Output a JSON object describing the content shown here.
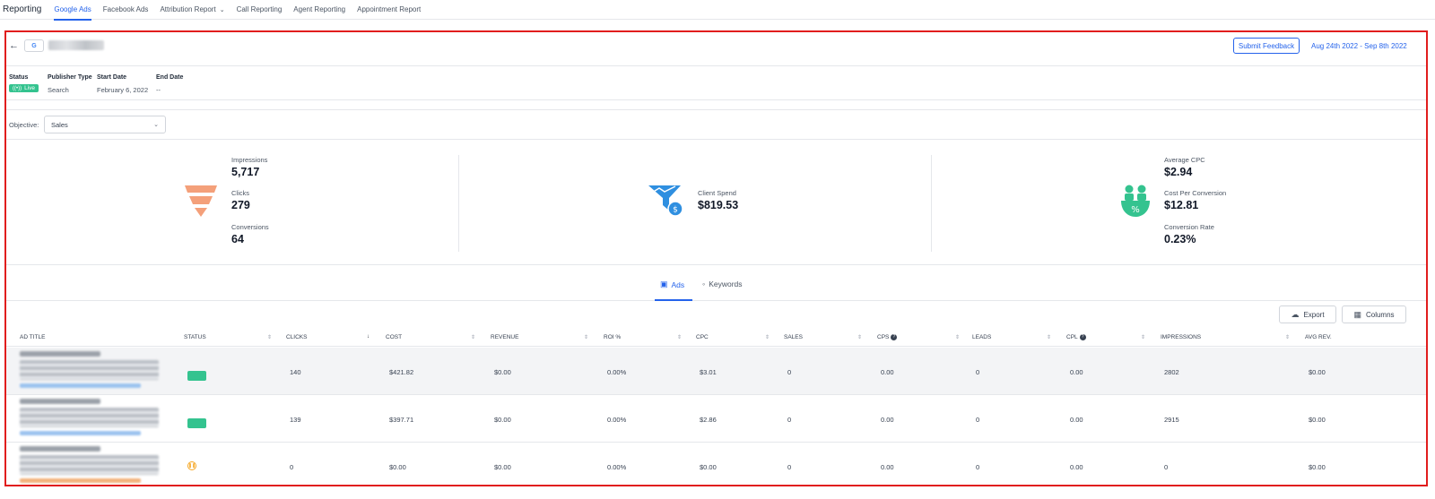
{
  "nav": {
    "brand": "Reporting",
    "tabs": [
      {
        "label": "Google Ads",
        "active": true
      },
      {
        "label": "Facebook Ads",
        "active": false
      },
      {
        "label": "Attribution Report",
        "active": false,
        "has_dropdown": true
      },
      {
        "label": "Call Reporting",
        "active": false
      },
      {
        "label": "Agent Reporting",
        "active": false
      },
      {
        "label": "Appointment Report",
        "active": false
      }
    ]
  },
  "header": {
    "google_badge": "G",
    "feedback_label": "Submit Feedback",
    "date_range": "Aug 24th 2022 - Sep 8th 2022"
  },
  "meta": {
    "status_label": "Status",
    "status_value": "Live",
    "publisher_label": "Publisher Type",
    "publisher_value": "Search",
    "start_label": "Start Date",
    "start_value": "February 6, 2022",
    "end_label": "End Date",
    "end_value": "--"
  },
  "objective": {
    "label": "Objective:",
    "value": "Sales"
  },
  "stats": {
    "impressions_label": "Impressions",
    "impressions_value": "5,717",
    "clicks_label": "Clicks",
    "clicks_value": "279",
    "conversions_label": "Conversions",
    "conversions_value": "64",
    "spend_label": "Client Spend",
    "spend_value": "$819.53",
    "avg_cpc_label": "Average CPC",
    "avg_cpc_value": "$2.94",
    "cpc_conv_label": "Cost Per Conversion",
    "cpc_conv_value": "$12.81",
    "conv_rate_label": "Conversion Rate",
    "conv_rate_value": "0.23%"
  },
  "content_tabs": {
    "ads": "Ads",
    "keywords": "Keywords"
  },
  "actions": {
    "export": "Export",
    "columns": "Columns"
  },
  "table": {
    "headers": {
      "ad_title": "AD TITLE",
      "status": "STATUS",
      "clicks": "CLICKS",
      "cost": "COST",
      "revenue": "REVENUE",
      "roi": "ROI %",
      "cpc": "CPC",
      "sales": "SALES",
      "cps": "CPS",
      "leads": "LEADS",
      "cpl": "CPL",
      "impressions": "IMPRESSIONS",
      "avg_rev": "AVG REV."
    },
    "rows": [
      {
        "status": "live",
        "clicks": "140",
        "cost": "$421.82",
        "revenue": "$0.00",
        "roi": "0.00%",
        "cpc": "$3.01",
        "sales": "0",
        "cps": "0.00",
        "leads": "0",
        "cpl": "0.00",
        "impressions": "2802",
        "avg_rev": "$0.00"
      },
      {
        "status": "live",
        "clicks": "139",
        "cost": "$397.71",
        "revenue": "$0.00",
        "roi": "0.00%",
        "cpc": "$2.86",
        "sales": "0",
        "cps": "0.00",
        "leads": "0",
        "cpl": "0.00",
        "impressions": "2915",
        "avg_rev": "$0.00"
      },
      {
        "status": "paused",
        "clicks": "0",
        "cost": "$0.00",
        "revenue": "$0.00",
        "roi": "0.00%",
        "cpc": "$0.00",
        "sales": "0",
        "cps": "0.00",
        "leads": "0",
        "cpl": "0.00",
        "impressions": "0",
        "avg_rev": "$0.00"
      }
    ]
  },
  "colors": {
    "accent": "#2563eb",
    "live_green": "#34c38f",
    "funnel_orange": "#f4a07a",
    "spend_blue": "#2f8fe0",
    "conversion_green": "#34c38f",
    "paused_orange": "#f5a623",
    "frame_red": "#e11d1d"
  },
  "icons": {
    "funnel": "funnel-icon",
    "spend": "spend-money-icon",
    "conversion": "people-percent-icon",
    "back": "arrow-left-icon",
    "export": "cloud-download-icon",
    "columns": "columns-grid-icon"
  }
}
